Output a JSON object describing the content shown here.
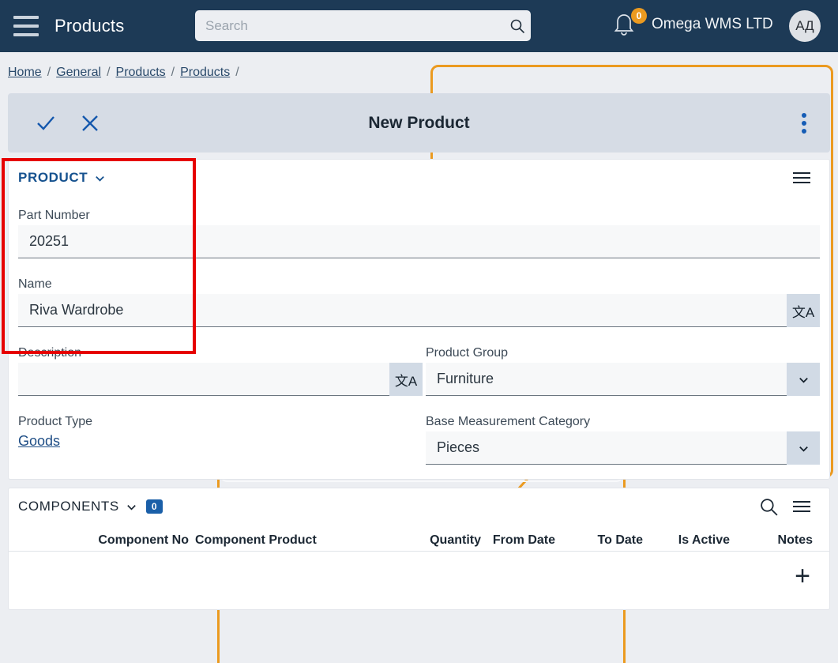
{
  "topbar": {
    "menu_icon": "hamburger-icon",
    "app_title": "Products",
    "search": {
      "value": "",
      "placeholder": "Search",
      "icon": "search-icon"
    },
    "notifications": {
      "icon": "bell-icon",
      "count": "0"
    },
    "organization": "Omega WMS LTD",
    "avatar_initials": "АД"
  },
  "breadcrumb": {
    "items": [
      {
        "label": "Home"
      },
      {
        "label": "General"
      },
      {
        "label": "Products"
      },
      {
        "label": "Products"
      }
    ],
    "separator": "/"
  },
  "record_toolbar": {
    "save_icon": "check-icon",
    "cancel_icon": "close-icon",
    "title": "New Product",
    "more_icon": "kebab-menu-icon"
  },
  "product_section": {
    "title": "PRODUCT",
    "collapse_icon": "chevron-down-icon",
    "menu_icon": "hamburger-menu-icon",
    "fields": {
      "part_number": {
        "label": "Part Number",
        "value": "20251"
      },
      "name": {
        "label": "Name",
        "value": "Riva Wardrobe",
        "adornment_icon": "translate-icon",
        "adornment_glyph": "文A"
      },
      "description": {
        "label": "Description",
        "value": "",
        "adornment_icon": "translate-icon",
        "adornment_glyph": "文A"
      },
      "product_type": {
        "label": "Product Type",
        "value": "Goods"
      },
      "product_group": {
        "label": "Product Group",
        "value": "Furniture",
        "adornment_icon": "chevron-down-icon"
      },
      "base_measurement_category": {
        "label": "Base Measurement Category",
        "value": "Pieces",
        "adornment_icon": "chevron-down-icon"
      }
    }
  },
  "components_section": {
    "title": "COMPONENTS",
    "collapse_icon": "chevron-down-icon",
    "count": "0",
    "search_icon": "search-icon",
    "menu_icon": "hamburger-menu-icon",
    "add_icon": "plus-icon",
    "columns": [
      "Component No",
      "Component Product",
      "Quantity",
      "From Date",
      "To Date",
      "Is Active",
      "Notes"
    ],
    "rows": []
  },
  "annotations": {
    "focus_box_color": "#e60000",
    "highlight_color": "#eb9a20"
  }
}
